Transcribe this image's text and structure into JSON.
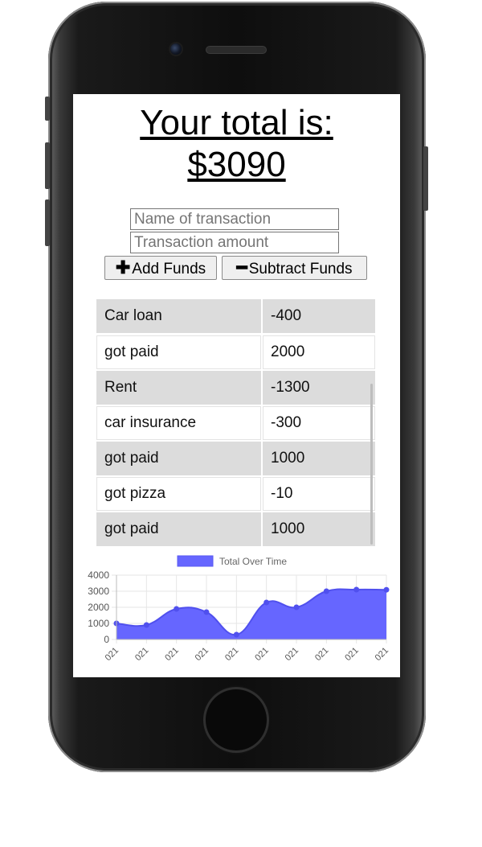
{
  "app": {
    "total_line": "Your total is:",
    "total_amount": "$3090"
  },
  "form": {
    "name_placeholder": "Name of transaction",
    "amount_placeholder": "Transaction amount",
    "add_icon": "plus-icon",
    "add_label": "Add Funds",
    "subtract_icon": "minus-icon",
    "subtract_label": "Subtract Funds"
  },
  "transactions": [
    {
      "name": "Car loan",
      "amount": "-400"
    },
    {
      "name": "got paid",
      "amount": "2000"
    },
    {
      "name": "Rent",
      "amount": "-1300"
    },
    {
      "name": "car insurance",
      "amount": "-300"
    },
    {
      "name": "got paid",
      "amount": "1000"
    },
    {
      "name": "got pizza",
      "amount": "-10"
    },
    {
      "name": "got paid",
      "amount": "1000"
    }
  ],
  "chart_data": {
    "type": "area",
    "title": "",
    "series": [
      {
        "name": "Total Over Time",
        "color": "#6666ff",
        "values": [
          1000,
          900,
          1900,
          1700,
          300,
          2300,
          2000,
          3000,
          3100,
          3090
        ]
      }
    ],
    "x_tick_labels": [
      "021",
      "021",
      "021",
      "021",
      "021",
      "021",
      "021",
      "021",
      "021",
      "021"
    ],
    "y_ticks": [
      0,
      1000,
      2000,
      3000,
      4000
    ],
    "ylim": [
      0,
      4000
    ],
    "grid": true,
    "legend_position": "top"
  }
}
